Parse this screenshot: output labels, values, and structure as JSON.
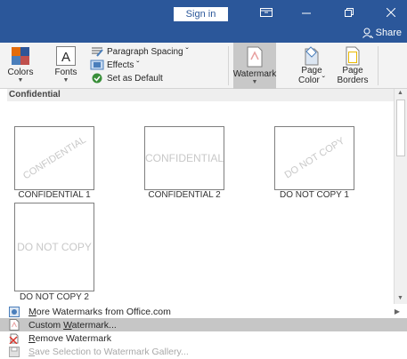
{
  "titlebar": {
    "sign_in": "Sign in",
    "share": "Share"
  },
  "ribbon": {
    "colors_label": "Colors",
    "fonts_label": "Fonts",
    "paragraph_spacing": "Paragraph Spacing ˇ",
    "effects": "Effects ˇ",
    "set_as_default": "Set as Default",
    "watermark_label": "Watermark",
    "page_color_line1": "Page",
    "page_color_line2": "Color ˇ",
    "page_borders_line1": "Page",
    "page_borders_line2": "Borders"
  },
  "gallery": {
    "header": "Confidential",
    "tiles": [
      {
        "watermark_text": "CONFIDENTIAL",
        "style": "diag",
        "label": "CONFIDENTIAL 1"
      },
      {
        "watermark_text": "CONFIDENTIAL",
        "style": "horiz",
        "label": "CONFIDENTIAL 2"
      },
      {
        "watermark_text": "DO NOT COPY",
        "style": "diag",
        "label": "DO NOT COPY 1"
      },
      {
        "watermark_text": "DO NOT COPY",
        "style": "horiz",
        "label": "DO NOT COPY 2"
      }
    ]
  },
  "menu": {
    "more_watermarks": {
      "pre": "",
      "mnemonic": "M",
      "post": "ore Watermarks from Office.com"
    },
    "custom_watermark": {
      "pre": "Custom ",
      "mnemonic": "W",
      "post": "atermark..."
    },
    "remove_watermark": {
      "pre": "",
      "mnemonic": "R",
      "post": "emove Watermark"
    },
    "save_selection": {
      "pre": "",
      "mnemonic": "S",
      "post": "ave Selection to Watermark Gallery..."
    }
  },
  "colors": {
    "titlebar": "#2b579a",
    "highlight": "#c6c6c6"
  }
}
